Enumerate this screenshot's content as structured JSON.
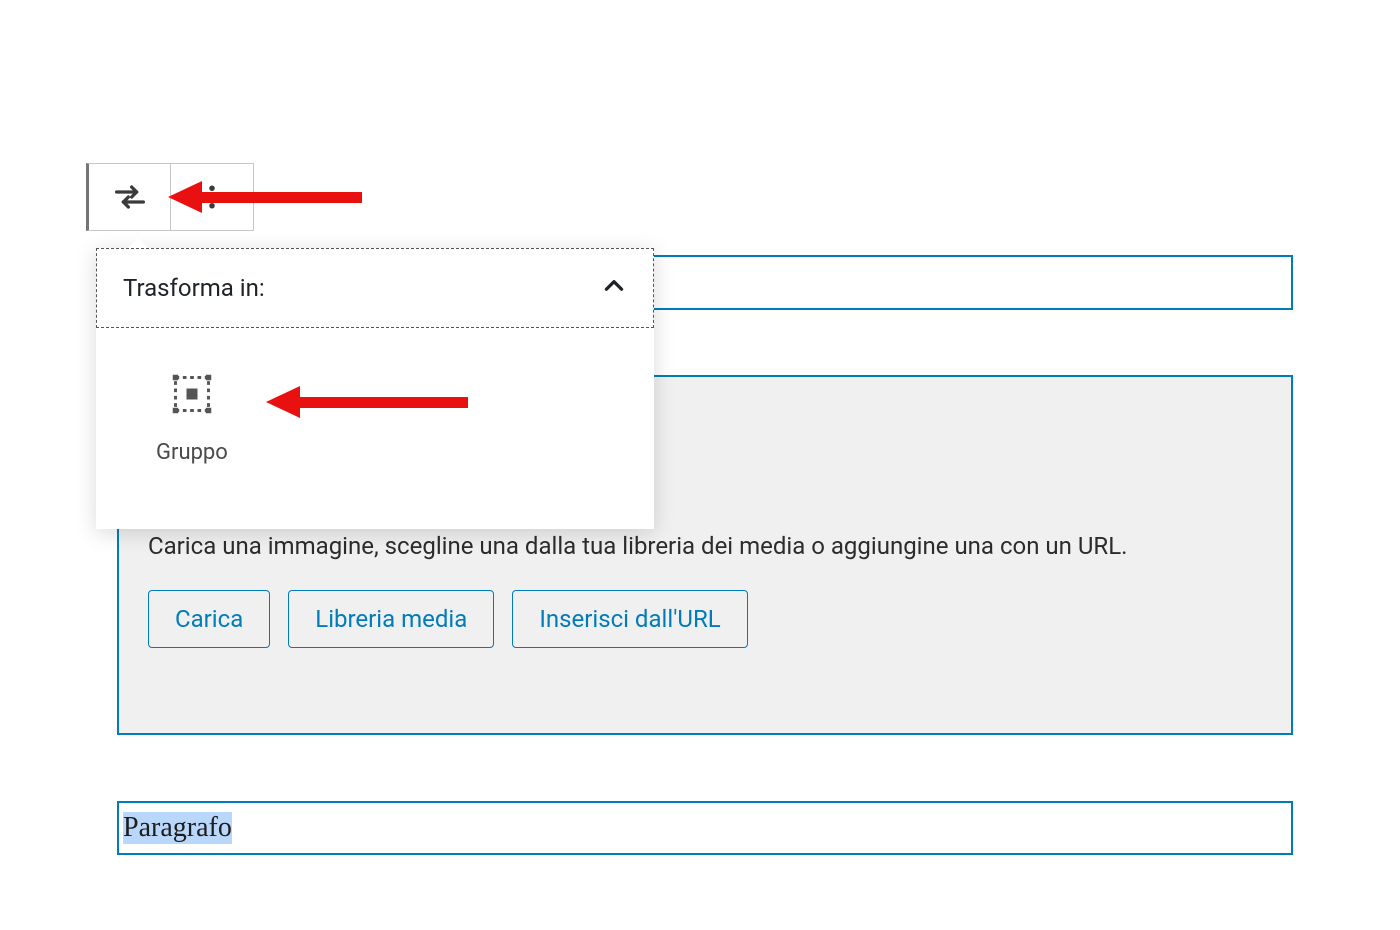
{
  "popover": {
    "title": "Trasforma in:",
    "options": [
      {
        "label": "Gruppo"
      }
    ]
  },
  "imageBlock": {
    "instruction": "Carica una immagine, scegline una dalla tua libreria dei media o aggiungine una con un URL.",
    "buttons": {
      "upload": "Carica",
      "mediaLibrary": "Libreria media",
      "insertFromUrl": "Inserisci dall'URL"
    }
  },
  "paragraphBlock": {
    "text": "Paragrafo"
  },
  "colors": {
    "accent": "#007cba",
    "arrow": "#e91010"
  }
}
